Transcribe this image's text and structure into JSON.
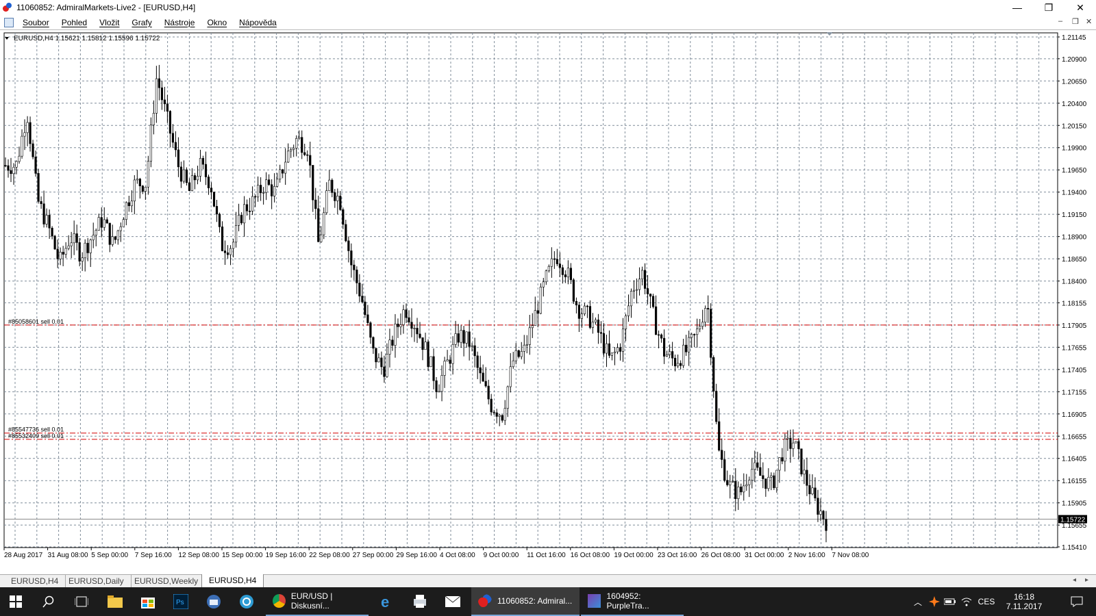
{
  "window": {
    "title": "11060852: AdmiralMarkets-Live2 - [EURUSD,H4]",
    "controls": [
      "—",
      "❐",
      "✕"
    ]
  },
  "menu": {
    "items": [
      "Soubor",
      "Pohled",
      "Vložit",
      "Grafy",
      "Nástroje",
      "Okno",
      "Nápověda"
    ],
    "mdi_controls": [
      "–",
      "❐",
      "✕"
    ]
  },
  "chart": {
    "header": "EURUSD,H4  1.15621 1.15812 1.15596 1.15722",
    "current_price_label": "1.15722",
    "orders": [
      {
        "label": "#85058601 sell 0.01",
        "price": 1.17905
      },
      {
        "label": "#85547736 sell 0.01",
        "price": 1.1669
      },
      {
        "label": "#85532409 sell 0.01",
        "price": 1.1662
      }
    ]
  },
  "chart_data": {
    "type": "candlestick",
    "symbol": "EURUSD",
    "timeframe": "H4",
    "y_ticks": [
      "1.21145",
      "1.20900",
      "1.20650",
      "1.20400",
      "1.20150",
      "1.19900",
      "1.19650",
      "1.19400",
      "1.19150",
      "1.18900",
      "1.18650",
      "1.18400",
      "1.18155",
      "1.17905",
      "1.17655",
      "1.17405",
      "1.17155",
      "1.16905",
      "1.16655",
      "1.16405",
      "1.16155",
      "1.15905",
      "1.15655",
      "1.15410"
    ],
    "ylim": [
      1.1541,
      1.21145
    ],
    "x_ticks": [
      "28 Aug 2017",
      "31 Aug 08:00",
      "5 Sep 00:00",
      "7 Sep 16:00",
      "12 Sep 08:00",
      "15 Sep 00:00",
      "19 Sep 16:00",
      "22 Sep 08:00",
      "27 Sep 00:00",
      "29 Sep 16:00",
      "4 Oct 08:00",
      "9 Oct 00:00",
      "11 Oct 16:00",
      "16 Oct 08:00",
      "19 Oct 00:00",
      "23 Oct 16:00",
      "26 Oct 08:00",
      "31 Oct 00:00",
      "2 Nov 16:00",
      "7 Nov 08:00"
    ],
    "grid": true,
    "close_path": [
      1.197,
      1.197,
      1.203,
      1.193,
      1.19,
      1.186,
      1.189,
      1.187,
      1.189,
      1.191,
      1.188,
      1.192,
      1.195,
      1.195,
      1.207,
      1.202,
      1.197,
      1.194,
      1.197,
      1.195,
      1.188,
      1.188,
      1.192,
      1.193,
      1.195,
      1.194,
      1.198,
      1.2,
      1.199,
      1.188,
      1.195,
      1.193,
      1.186,
      1.182,
      1.176,
      1.174,
      1.178,
      1.181,
      1.179,
      1.176,
      1.172,
      1.175,
      1.178,
      1.177,
      1.173,
      1.17,
      1.169,
      1.175,
      1.176,
      1.18,
      1.184,
      1.187,
      1.185,
      1.181,
      1.18,
      1.178,
      1.175,
      1.177,
      1.183,
      1.185,
      1.18,
      1.176,
      1.175,
      1.176,
      1.178,
      1.182,
      1.165,
      1.161,
      1.16,
      1.163,
      1.162,
      1.161,
      1.165,
      1.166,
      1.162,
      1.159,
      1.157
    ]
  },
  "tabs": [
    "EURUSD,H4",
    "EURUSD,Daily",
    "EURUSD,Weekly",
    "EURUSD,H4"
  ],
  "taskbar": {
    "tasks": [
      {
        "label": "EUR/USD | Diskusní...",
        "color": "#e8a21b"
      },
      {
        "label": "11060852: Admiral...",
        "color": "#e02020"
      },
      {
        "label": "1604952: PurpleTra...",
        "color": "#7a3fb0"
      }
    ],
    "language": "CES",
    "time": "16:18",
    "date": "7.11.2017",
    "pinned_icons": [
      "windows-icon",
      "search-icon",
      "task-view-icon",
      "file-explorer-icon",
      "store-icon",
      "photoshop-icon",
      "thunderbird-icon",
      "app-icon",
      "chrome-icon",
      "edge-icon",
      "printer-icon",
      "mail-icon"
    ]
  },
  "colors": {
    "order_line": "#d40000",
    "grid": "#7f8c99",
    "candle": "#000000"
  }
}
